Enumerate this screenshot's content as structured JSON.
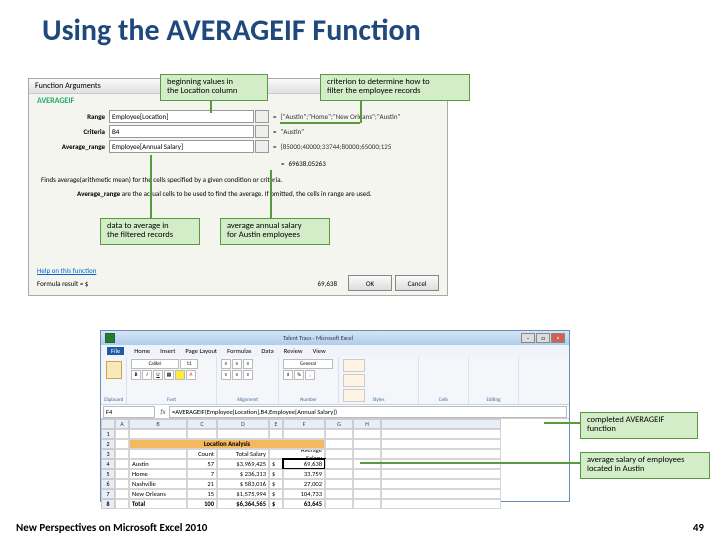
{
  "slide": {
    "title": "Using the AVERAGEIF Function",
    "footer_left": "New Perspectives on Microsoft Excel 2010",
    "footer_right": "49"
  },
  "callouts": {
    "c1": "beginning values in\nthe Location column",
    "c2": "criterion to determine how to\nfilter the employee records",
    "c3": "data to average in\nthe filtered records",
    "c4": "average annual salary\nfor Austin employees",
    "c5": "completed AVERAGEIF\nfunction",
    "c6": "average salary of employees\nlocated in Austin"
  },
  "fa": {
    "dialog_title": "Function Arguments",
    "fn_name": "AVERAGEIF",
    "labels": {
      "range": "Range",
      "criteria": "Criteria",
      "avg": "Average_range"
    },
    "inputs": {
      "range": "Employee[Location]",
      "criteria": "B4",
      "avg": "Employee[Annual Salary]"
    },
    "previews": {
      "range": "{\"Austin\";\"Home\";\"New Orleans\";\"Austin\"",
      "criteria": "\"Austin\"",
      "avg": "{85000;40000;33744;80000;65000;125"
    },
    "result_preview": "69638.05263",
    "desc": "Finds average(arithmetic mean) for the cells specified by a given condition or criteria.",
    "desc2_bold": "Average_range",
    "desc2_rest": " are the actual cells to be used to find the average. If omitted, the cells in range are used.",
    "formula_result_label": "Formula result =  $",
    "formula_result_val": "69,638",
    "help_link": "Help on this function",
    "ok": "OK",
    "cancel": "Cancel"
  },
  "excel": {
    "window_title": "Talent Tracs - Microsoft Excel",
    "menu": [
      "File",
      "Home",
      "Insert",
      "Page Layout",
      "Formulas",
      "Data",
      "Review",
      "View"
    ],
    "ribbon_groups": [
      "Clipboard",
      "Font",
      "Alignment",
      "Number",
      "Styles",
      "Cells",
      "Editing"
    ],
    "namebox": "F4",
    "formula": "=AVERAGEIF(Employee[Location],B4,Employee[Annual Salary])",
    "col_headers": [
      "A",
      "B",
      "C",
      "D",
      "E",
      "F",
      "G",
      "H"
    ],
    "header_merged": "Location Analysis",
    "header_row": {
      "count": "Count",
      "totsal": "Total Salary",
      "avgsal_top": "Average",
      "avgsal_bot": "Salary"
    },
    "rows": [
      {
        "n": "4",
        "loc": "Austin",
        "count": "57",
        "tot": "$3,969,425",
        "cur": "$",
        "avg": "69,638"
      },
      {
        "n": "5",
        "loc": "Home",
        "count": "7",
        "tot": "$  236,313",
        "cur": "$",
        "avg": "33,759"
      },
      {
        "n": "6",
        "loc": "Nashville",
        "count": "21",
        "tot": "$  583,016",
        "cur": "$",
        "avg": "27,002"
      },
      {
        "n": "7",
        "loc": "New Orleans",
        "count": "15",
        "tot": "$1,575,994",
        "cur": "$",
        "avg": "104,733"
      },
      {
        "n": "8",
        "loc": "Total",
        "count": "100",
        "tot": "$6,364,565",
        "cur": "$",
        "avg": "63,645"
      }
    ]
  }
}
